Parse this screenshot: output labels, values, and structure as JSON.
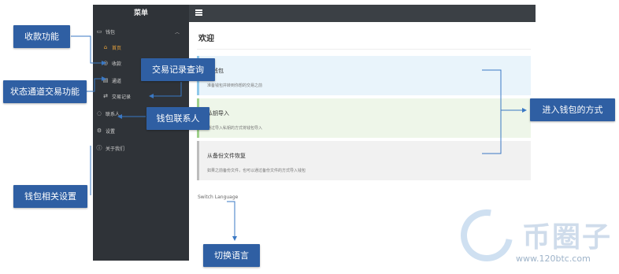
{
  "sidebar": {
    "title": "菜单",
    "items": [
      {
        "label": "钱包",
        "icon": "wallet-icon"
      },
      {
        "label": "首页",
        "icon": "home-icon"
      },
      {
        "label": "收款",
        "icon": "receive-icon"
      },
      {
        "label": "通道",
        "icon": "channel-icon"
      },
      {
        "label": "交易记录",
        "icon": "transactions-icon"
      },
      {
        "label": "联系人",
        "icon": "contacts-icon"
      },
      {
        "label": "设置",
        "icon": "settings-icon"
      },
      {
        "label": "关于我们",
        "icon": "info-icon"
      }
    ]
  },
  "main": {
    "title": "欢迎",
    "cards": [
      {
        "title": "备钱包",
        "desc": "准备钱包并转到你想的交易之前"
      },
      {
        "title": "私钥导入",
        "desc": "通过导入私钥的方式将钱包导入"
      },
      {
        "title": "从备份文件恢复",
        "desc": "如果之前备份文件，也可以通过备份文件的方式导入钱包"
      }
    ],
    "language_link": "Switch Language"
  },
  "annotations": {
    "receive": "收款功能",
    "status_channel": "状态通道交易功能",
    "tx_query": "交易记录查询",
    "contacts": "钱包联系人",
    "settings": "钱包相关设置",
    "enter_wallet": "进入钱包的方式",
    "switch_lang": "切换语言"
  },
  "watermark": {
    "name": "币圈子",
    "url": "www.120btc.com"
  },
  "colors": {
    "label_bg": "#2f5fa3",
    "sidebar_bg": "#2f3338",
    "active": "#e6a23c",
    "arrow": "#3a78c4"
  }
}
